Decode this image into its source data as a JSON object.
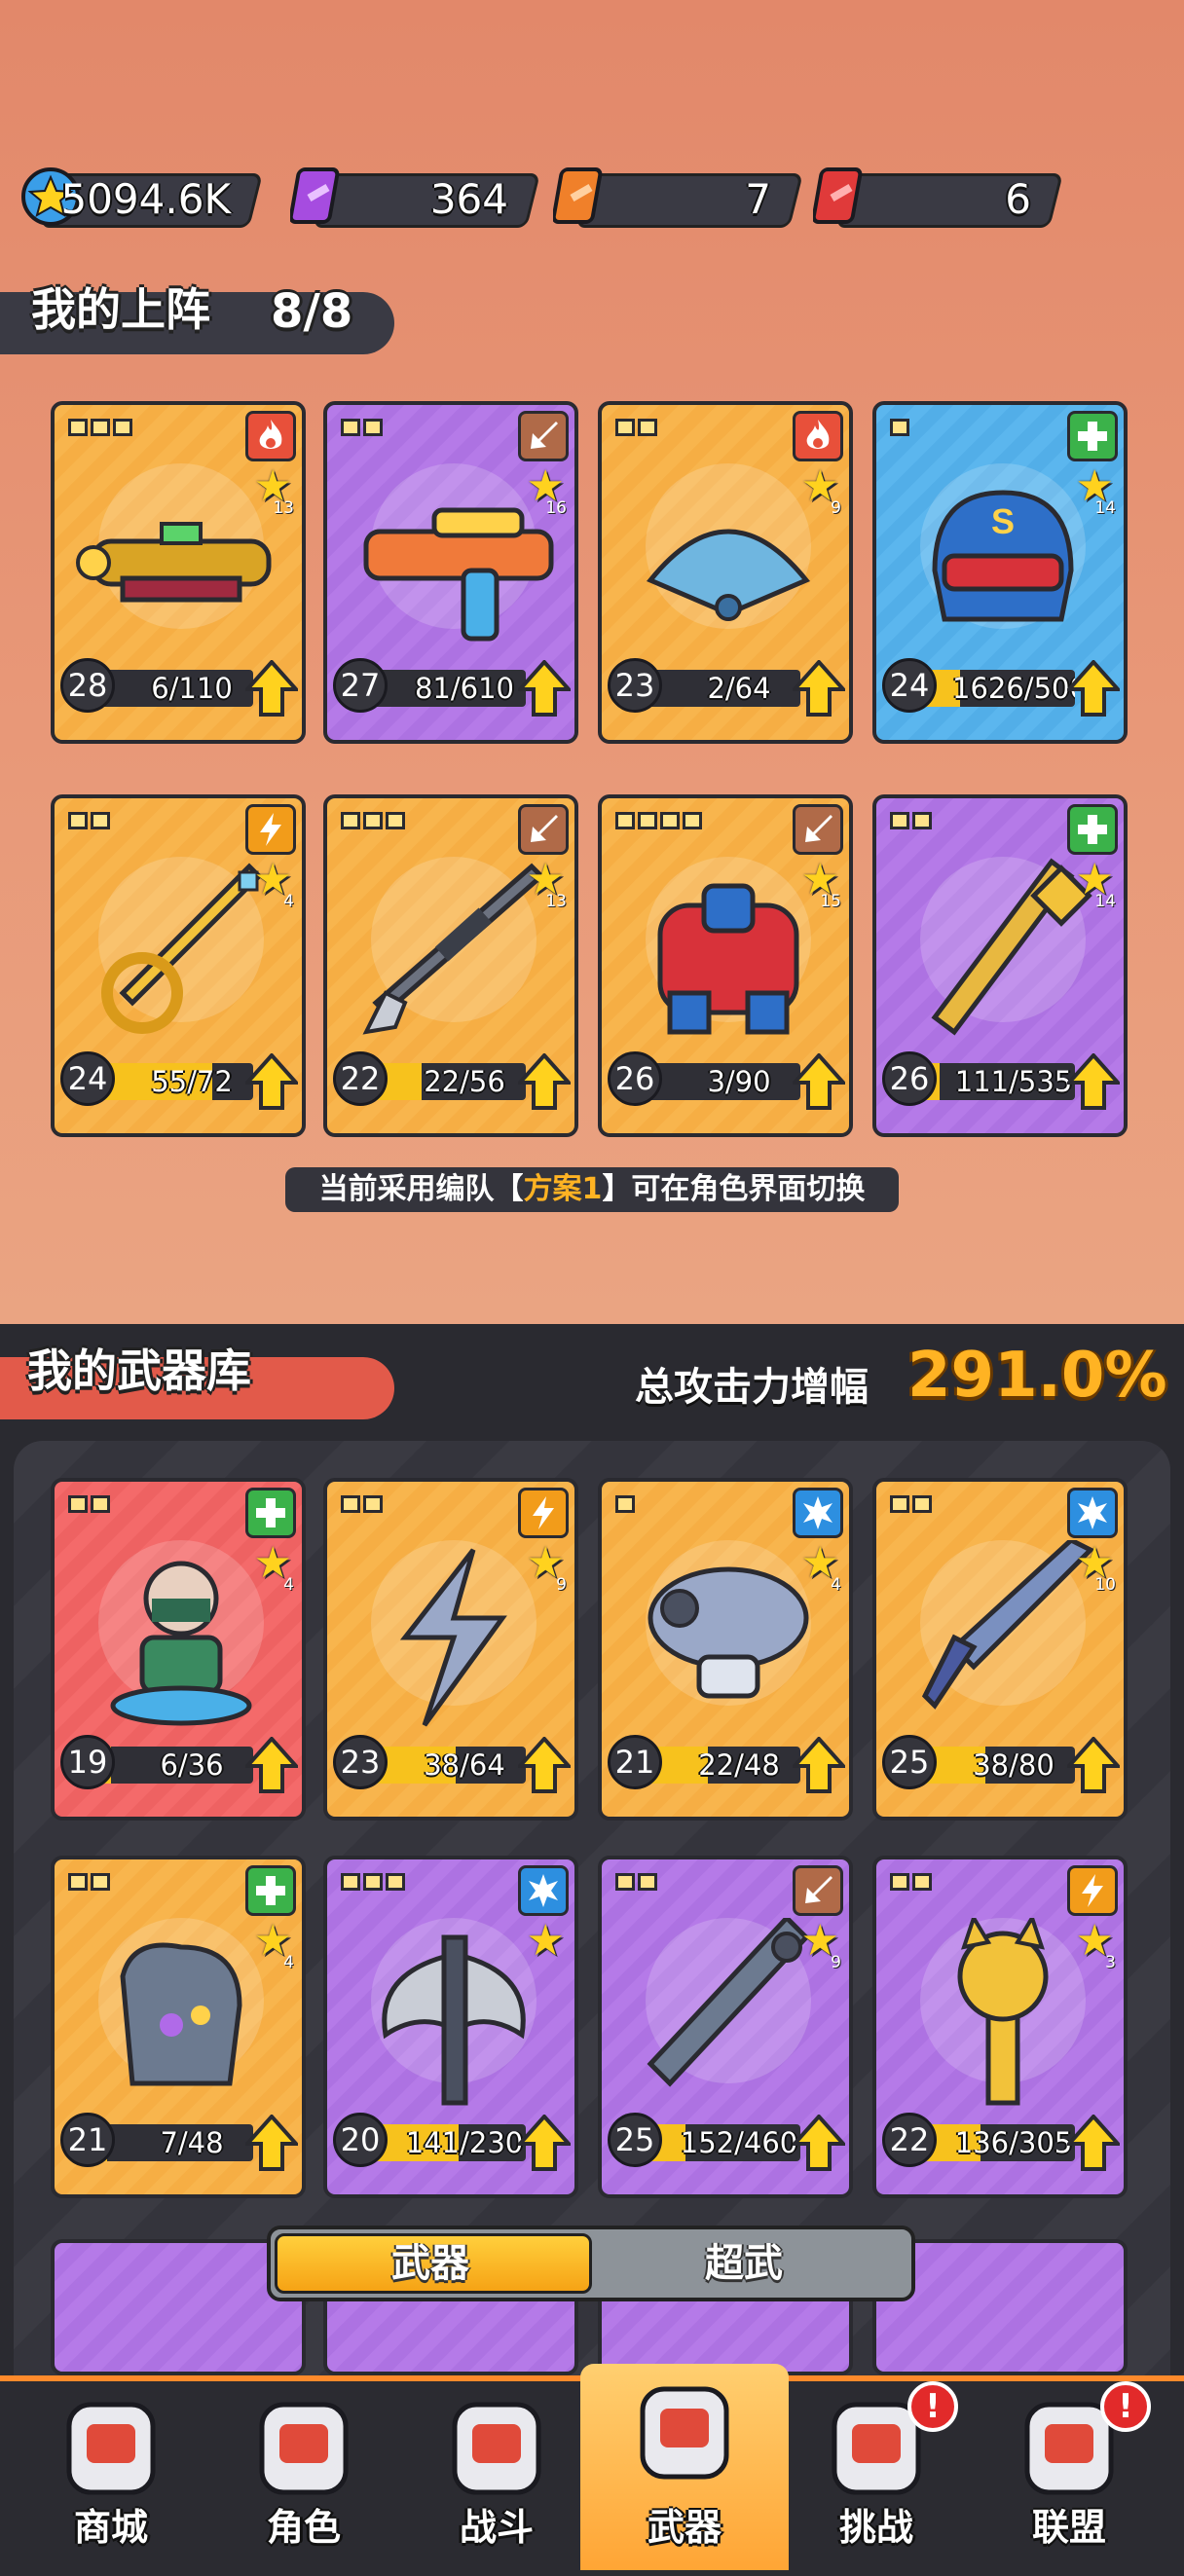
{
  "currency": [
    {
      "icon": "blue-coin-icon",
      "value": "5094.6K"
    },
    {
      "icon": "purple-ticket-icon",
      "value": "364"
    },
    {
      "icon": "orange-ticket-icon",
      "value": "7"
    },
    {
      "icon": "red-ticket-icon",
      "value": "6"
    }
  ],
  "lineup": {
    "title": "我的上阵",
    "count": "8/8",
    "hint_prefix": "当前采用编队【",
    "hint_plan": "方案1",
    "hint_suffix": "】可在角色界面切换",
    "cards": [
      {
        "rarity": "orange",
        "slots": 3,
        "type": "fire",
        "type_color": "#e8503a",
        "stars": "13",
        "level": "28",
        "progress": "6/110",
        "fill": 0.05,
        "art": "golden-gatling-gun-icon"
      },
      {
        "rarity": "purple",
        "slots": 2,
        "type": "pierce",
        "type_color": "#b06a48",
        "stars": "16",
        "level": "27",
        "progress": "81/610",
        "fill": 0.13,
        "art": "water-blaster-gun-icon"
      },
      {
        "rarity": "orange",
        "slots": 2,
        "type": "fire",
        "type_color": "#e8503a",
        "stars": "9",
        "level": "23",
        "progress": "2/64",
        "fill": 0.03,
        "art": "iron-fan-icon"
      },
      {
        "rarity": "blue",
        "slots": 1,
        "type": "heal",
        "type_color": "#3bb24a",
        "stars": "14",
        "level": "24",
        "progress": "1626/5000",
        "fill": 0.33,
        "art": "hero-helmet-icon"
      },
      {
        "rarity": "orange",
        "slots": 2,
        "type": "lightning",
        "type_color": "#f29c1a",
        "stars": "4",
        "level": "24",
        "progress": "55/72",
        "fill": 0.76,
        "art": "golden-scepter-icon"
      },
      {
        "rarity": "orange",
        "slots": 3,
        "type": "pierce",
        "type_color": "#b06a48",
        "stars": "13",
        "level": "22",
        "progress": "22/56",
        "fill": 0.39,
        "art": "sniper-rifle-icon"
      },
      {
        "rarity": "orange",
        "slots": 4,
        "type": "pierce",
        "type_color": "#b06a48",
        "stars": "15",
        "level": "26",
        "progress": "3/90",
        "fill": 0.03,
        "art": "mech-robot-icon"
      },
      {
        "rarity": "purple",
        "slots": 2,
        "type": "heal",
        "type_color": "#3bb24a",
        "stars": "14",
        "level": "26",
        "progress": "111/535",
        "fill": 0.21,
        "art": "golden-stick-icon"
      }
    ]
  },
  "arsenal": {
    "title": "我的武器库",
    "boost_label": "总攻击力增幅",
    "boost_value": "291.0%",
    "cards": [
      {
        "rarity": "red",
        "slots": 2,
        "type": "heal",
        "type_color": "#3bb24a",
        "stars": "4",
        "level": "19",
        "progress": "6/36",
        "fill": 0.17,
        "art": "masked-hero-figure-icon"
      },
      {
        "rarity": "orange",
        "slots": 2,
        "type": "lightning",
        "type_color": "#f29c1a",
        "stars": "9",
        "level": "23",
        "progress": "38/64",
        "fill": 0.59,
        "art": "lightning-bolt-icon"
      },
      {
        "rarity": "orange",
        "slots": 1,
        "type": "frost",
        "type_color": "#2d8fe0",
        "stars": "4",
        "level": "21",
        "progress": "22/48",
        "fill": 0.46,
        "art": "mushroom-turret-icon"
      },
      {
        "rarity": "orange",
        "slots": 2,
        "type": "frost",
        "type_color": "#2d8fe0",
        "stars": "10",
        "level": "25",
        "progress": "38/80",
        "fill": 0.48,
        "art": "ice-sword-icon"
      },
      {
        "rarity": "orange",
        "slots": 2,
        "type": "heal",
        "type_color": "#3bb24a",
        "stars": "4",
        "level": "21",
        "progress": "7/48",
        "fill": 0.15,
        "art": "gauntlet-icon"
      },
      {
        "rarity": "purple",
        "slots": 3,
        "type": "frost",
        "type_color": "#2d8fe0",
        "stars": "",
        "level": "20",
        "progress": "141/230",
        "fill": 0.61,
        "art": "battle-axe-icon"
      },
      {
        "rarity": "purple",
        "slots": 2,
        "type": "pierce",
        "type_color": "#b06a48",
        "stars": "9",
        "level": "25",
        "progress": "152/460",
        "fill": 0.33,
        "art": "steel-pipe-icon"
      },
      {
        "rarity": "purple",
        "slots": 2,
        "type": "lightning",
        "type_color": "#f29c1a",
        "stars": "3",
        "level": "22",
        "progress": "136/305",
        "fill": 0.45,
        "art": "cat-scepter-icon"
      }
    ]
  },
  "toggle": {
    "weapons": "武器",
    "super": "超武"
  },
  "nav": [
    {
      "label": "商城",
      "icon": "vending-machine-icon",
      "badge": ""
    },
    {
      "label": "角色",
      "icon": "character-hood-icon",
      "badge": ""
    },
    {
      "label": "战斗",
      "icon": "battle-monster-icon",
      "badge": ""
    },
    {
      "label": "武器",
      "icon": "backpack-icon",
      "badge": "",
      "active": true
    },
    {
      "label": "挑战",
      "icon": "dumbbell-icon",
      "badge": "!"
    },
    {
      "label": "联盟",
      "icon": "shield-emblem-icon",
      "badge": "!"
    }
  ]
}
